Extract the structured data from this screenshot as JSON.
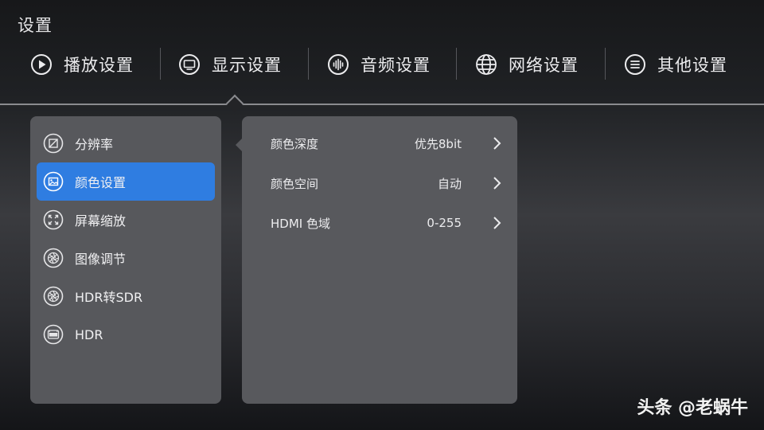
{
  "page": {
    "title": "设置"
  },
  "tabs": [
    {
      "label": "播放设置",
      "icon": "play-icon"
    },
    {
      "label": "显示设置",
      "icon": "monitor-icon",
      "selected": true
    },
    {
      "label": "音频设置",
      "icon": "audio-wave-icon"
    },
    {
      "label": "网络设置",
      "icon": "globe-icon"
    },
    {
      "label": "其他设置",
      "icon": "menu-lines-icon"
    }
  ],
  "sidebar": {
    "items": [
      {
        "label": "分辨率",
        "icon": "resolution-icon"
      },
      {
        "label": "颜色设置",
        "icon": "image-icon",
        "active": true
      },
      {
        "label": "屏幕缩放",
        "icon": "expand-icon"
      },
      {
        "label": "图像调节",
        "icon": "aperture-icon"
      },
      {
        "label": "HDR转SDR",
        "icon": "aperture-icon"
      },
      {
        "label": "HDR",
        "icon": "hdr-icon"
      }
    ]
  },
  "settings": {
    "rows": [
      {
        "label": "颜色深度",
        "value": "优先8bit"
      },
      {
        "label": "颜色空间",
        "value": "自动"
      },
      {
        "label": "HDMI 色域",
        "value": "0-255"
      }
    ]
  },
  "watermark": {
    "text": "头条 @老蜗牛"
  },
  "colors": {
    "accent": "#2f7de1",
    "panel": "#58595d",
    "text": "#ececee"
  }
}
